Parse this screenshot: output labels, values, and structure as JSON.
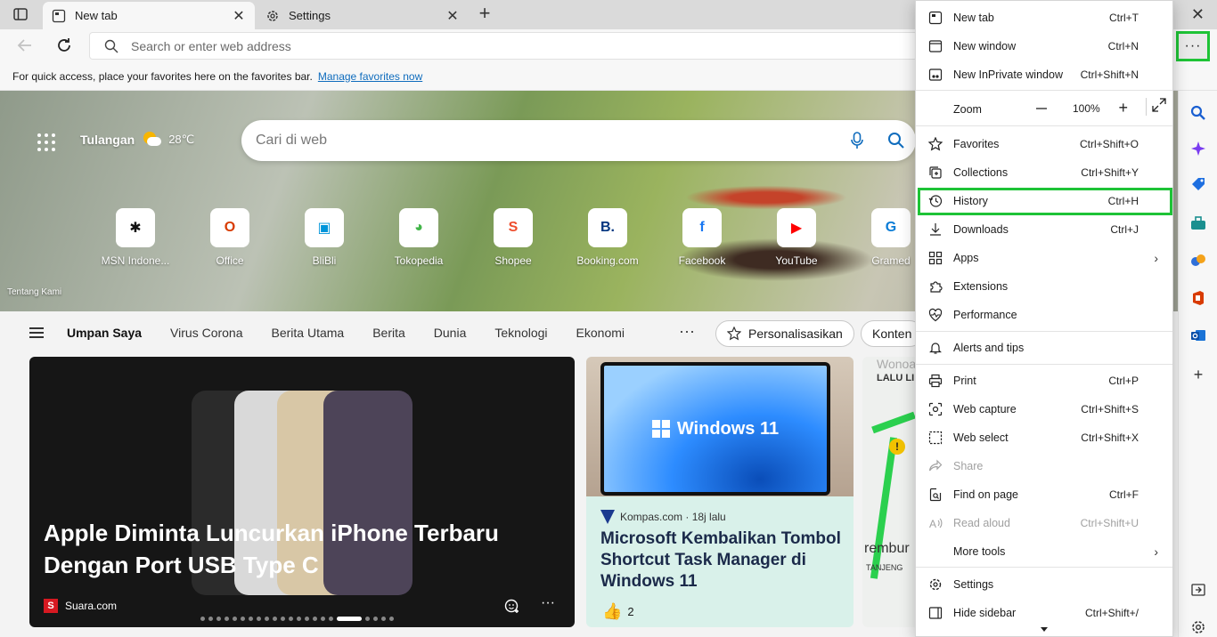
{
  "tabs": {
    "active": {
      "title": "New tab",
      "close": "✕"
    },
    "inactive": {
      "title": "Settings",
      "close": "✕"
    },
    "new_tab": "+",
    "window_close": "✕"
  },
  "address_bar": {
    "placeholder": "Search or enter web address"
  },
  "favorites_bar": {
    "message": "For quick access, place your favorites here on the favorites bar.",
    "link": "Manage favorites now"
  },
  "more_button": {
    "label": "···"
  },
  "hero": {
    "location": "Tulangan",
    "temperature": "28℃",
    "search_placeholder": "Cari di web",
    "about": "Tentang Kami",
    "tiles": [
      {
        "label": "MSN Indone...",
        "icon": "msn-icon",
        "glyph": "✱",
        "color": "#111111"
      },
      {
        "label": "Office",
        "icon": "office-icon",
        "glyph": "O",
        "color": "#d83b01"
      },
      {
        "label": "BliBli",
        "icon": "blibli-icon",
        "glyph": "▣",
        "color": "#0095da"
      },
      {
        "label": "Tokopedia",
        "icon": "tokopedia-icon",
        "glyph": "◕",
        "color": "#42b549"
      },
      {
        "label": "Shopee",
        "icon": "shopee-icon",
        "glyph": "S",
        "color": "#ee4d2d"
      },
      {
        "label": "Booking.com",
        "icon": "booking-icon",
        "glyph": "B.",
        "color": "#003580"
      },
      {
        "label": "Facebook",
        "icon": "facebook-icon",
        "glyph": "f",
        "color": "#1877f2"
      },
      {
        "label": "YouTube",
        "icon": "youtube-icon",
        "glyph": "▶",
        "color": "#ff0000"
      },
      {
        "label": "Gramed",
        "icon": "gramedia-icon",
        "glyph": "G",
        "color": "#0a7cd6"
      }
    ]
  },
  "feed": {
    "tabs": [
      "Umpan Saya",
      "Virus Corona",
      "Berita Utama",
      "Berita",
      "Dunia",
      "Teknologi",
      "Ekonomi"
    ],
    "more": "···",
    "personalize": "Personalisasikan",
    "content": "Konten"
  },
  "cards": {
    "main": {
      "headline": "Apple Diminta Luncurkan iPhone Terbaru Dengan Port USB Type C",
      "source": "Suara.com",
      "source_logo": "S",
      "more": "···"
    },
    "second": {
      "image_text": "Windows 11",
      "source": "Kompas.com · 18j lalu",
      "headline": "Microsoft Kembalikan Tombol Shortcut Task Manager di Windows 11",
      "likes": "2"
    },
    "third": {
      "label_top": "LALU LI",
      "label_mid": "rembur",
      "label_bottom": "TANJENG",
      "watermark": "Wonoa"
    }
  },
  "menu": {
    "items": [
      {
        "label": "New tab",
        "shortcut": "Ctrl+T",
        "icon": "new-tab-icon"
      },
      {
        "label": "New window",
        "shortcut": "Ctrl+N",
        "icon": "new-window-icon"
      },
      {
        "label": "New InPrivate window",
        "shortcut": "Ctrl+Shift+N",
        "icon": "inprivate-icon"
      },
      {
        "label": "Favorites",
        "shortcut": "Ctrl+Shift+O",
        "icon": "favorites-icon"
      },
      {
        "label": "Collections",
        "shortcut": "Ctrl+Shift+Y",
        "icon": "collections-icon"
      },
      {
        "label": "History",
        "shortcut": "Ctrl+H",
        "icon": "history-icon"
      },
      {
        "label": "Downloads",
        "shortcut": "Ctrl+J",
        "icon": "downloads-icon"
      },
      {
        "label": "Apps",
        "shortcut": "",
        "icon": "apps-icon"
      },
      {
        "label": "Extensions",
        "shortcut": "",
        "icon": "extensions-icon"
      },
      {
        "label": "Performance",
        "shortcut": "",
        "icon": "performance-icon"
      },
      {
        "label": "Alerts and tips",
        "shortcut": "",
        "icon": "alerts-icon"
      },
      {
        "label": "Print",
        "shortcut": "Ctrl+P",
        "icon": "print-icon"
      },
      {
        "label": "Web capture",
        "shortcut": "Ctrl+Shift+S",
        "icon": "web-capture-icon"
      },
      {
        "label": "Web select",
        "shortcut": "Ctrl+Shift+X",
        "icon": "web-select-icon"
      },
      {
        "label": "Share",
        "shortcut": "",
        "icon": "share-icon"
      },
      {
        "label": "Find on page",
        "shortcut": "Ctrl+F",
        "icon": "find-icon"
      },
      {
        "label": "Read aloud",
        "shortcut": "Ctrl+Shift+U",
        "icon": "read-aloud-icon"
      },
      {
        "label": "More tools",
        "shortcut": "",
        "icon": "more-tools-icon"
      },
      {
        "label": "Settings",
        "shortcut": "",
        "icon": "settings-icon"
      },
      {
        "label": "Hide sidebar",
        "shortcut": "Ctrl+Shift+/",
        "icon": "hide-sidebar-icon"
      }
    ],
    "zoom": {
      "label": "Zoom",
      "value": "100%",
      "minus": "—",
      "plus": "+"
    },
    "submenu_arrow": "›"
  },
  "colors": {
    "highlight": "#1ec336",
    "accent": "#0f6cbd"
  }
}
